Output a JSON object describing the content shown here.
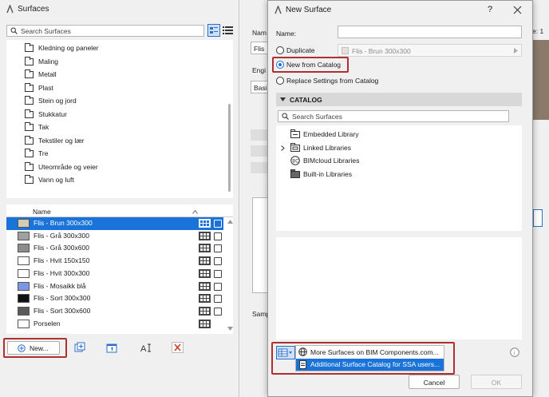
{
  "surfaces_window": {
    "title": "Surfaces",
    "search_placeholder": "Search Surfaces",
    "folders": [
      "Kledning og paneler",
      "Maling",
      "Metall",
      "Plast",
      "Stein og jord",
      "Stukkatur",
      "Tak",
      "Tekstiler og lær",
      "Tre",
      "Uteområde og veier",
      "Vann og luft"
    ],
    "list_header": "Name",
    "items": [
      {
        "name": "Flis - Brun 300x300",
        "color": "#d3cbb5"
      },
      {
        "name": "Flis - Grå 300x300",
        "color": "#a0a0a0"
      },
      {
        "name": "Flis - Grå 300x600",
        "color": "#8c8c8c"
      },
      {
        "name": "Flis - Hvit 150x150",
        "color": "#ffffff"
      },
      {
        "name": "Flis - Hvit 300x300",
        "color": "#ffffff"
      },
      {
        "name": "Flis - Mosaikk blå",
        "color": "#7c96e6"
      },
      {
        "name": "Flis - Sort 300x300",
        "color": "#111111"
      },
      {
        "name": "Flis - Sort 300x600",
        "color": "#5a5a5a"
      },
      {
        "name": "Porselen",
        "color": "#ffffff"
      }
    ],
    "new_button": "New..."
  },
  "background_panel": {
    "name_label": "Nam",
    "field_value": "Flis",
    "engine_label": "Engi",
    "basic_value": "Basi",
    "sample_label": "Samp",
    "right_hint": "e: 1"
  },
  "dialog": {
    "title": "New Surface",
    "help": "?",
    "name_label": "Name:",
    "name_value": "",
    "duplicate_label": "Duplicate",
    "duplicate_value": "Flis - Brun 300x300",
    "new_from_catalog_label": "New from Catalog",
    "replace_label": "Replace Settings from Catalog",
    "catalog_header": "CATALOG",
    "catalog_search_placeholder": "Search Surfaces",
    "libraries": [
      "Embedded Library",
      "Linked Libraries",
      "BIMcloud Libraries",
      "Built-in Libraries"
    ],
    "menu_items": [
      "More Surfaces on BIM Components.com...",
      "Additional Surface Catalog for SSA users..."
    ],
    "cancel_label": "Cancel",
    "ok_label": "OK",
    "info": "i"
  },
  "colors": {
    "selection": "#1a73d9",
    "highlight_box": "#b03030"
  }
}
